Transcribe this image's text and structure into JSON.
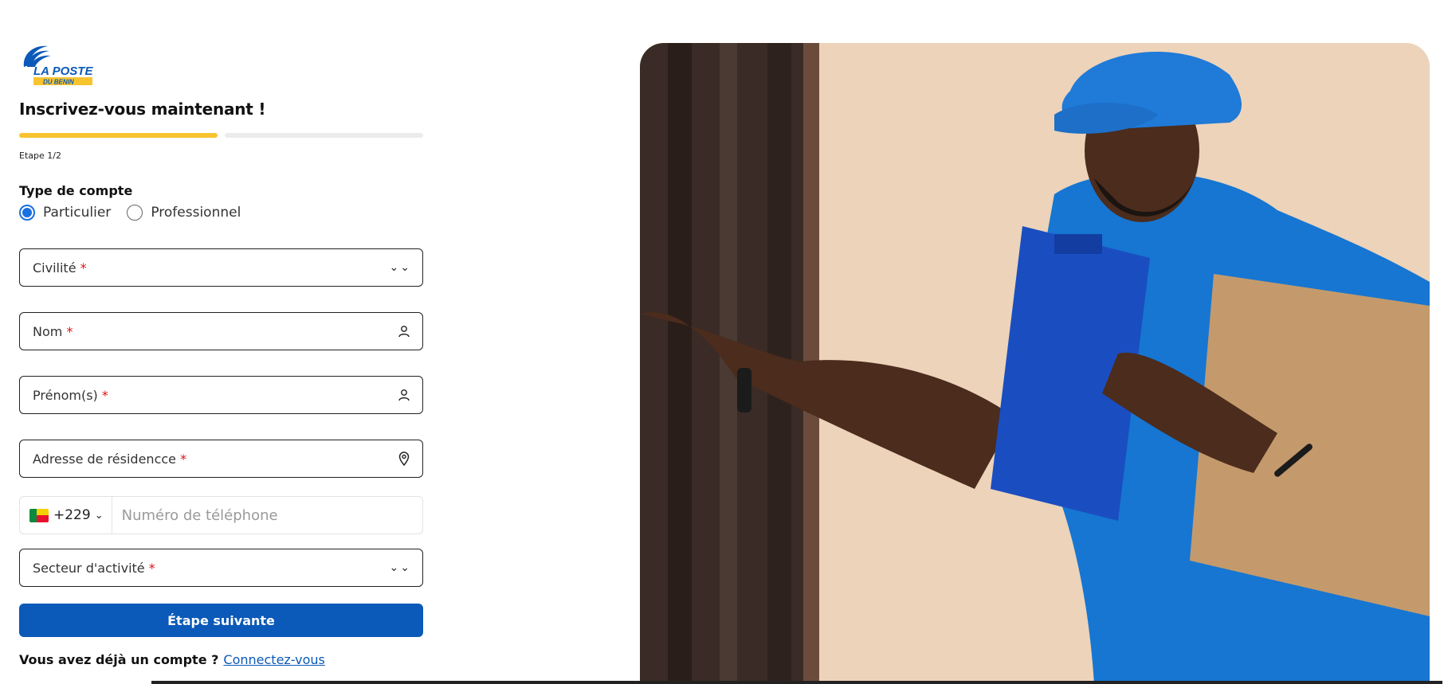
{
  "brand": {
    "name": "LA POSTE",
    "subname": "DU BENIN",
    "blue": "#0b59b8",
    "yellow": "#f7c430"
  },
  "signup": {
    "title": "Inscrivez-vous maintenant !",
    "progress": {
      "current_step": 1,
      "total_steps": 2,
      "label": "Etape 1/2"
    },
    "account_type": {
      "label": "Type de compte",
      "options": [
        "Particulier",
        "Professionnel"
      ],
      "selected": "Particulier"
    },
    "fields": {
      "civilite": {
        "label": "Civilité",
        "required_mark": "*"
      },
      "nom": {
        "label": "Nom",
        "required_mark": "*"
      },
      "prenoms": {
        "label": "Prénom(s)",
        "required_mark": "*"
      },
      "adresse": {
        "label": "Adresse de résidencce",
        "required_mark": "*"
      },
      "secteur": {
        "label": "Secteur d'activité",
        "required_mark": "*"
      }
    },
    "phone": {
      "country_code": "+229",
      "placeholder": "Numéro de téléphone"
    },
    "next_button": "Étape suivante",
    "login_prompt": "Vous avez déjà un compte ?",
    "login_link": "Connectez-vous"
  },
  "icons": {
    "civilite": "chevron-down-icon",
    "nom": "user-icon",
    "prenoms": "user-icon",
    "adresse": "location-pin-icon",
    "secteur": "chevron-down-icon"
  }
}
